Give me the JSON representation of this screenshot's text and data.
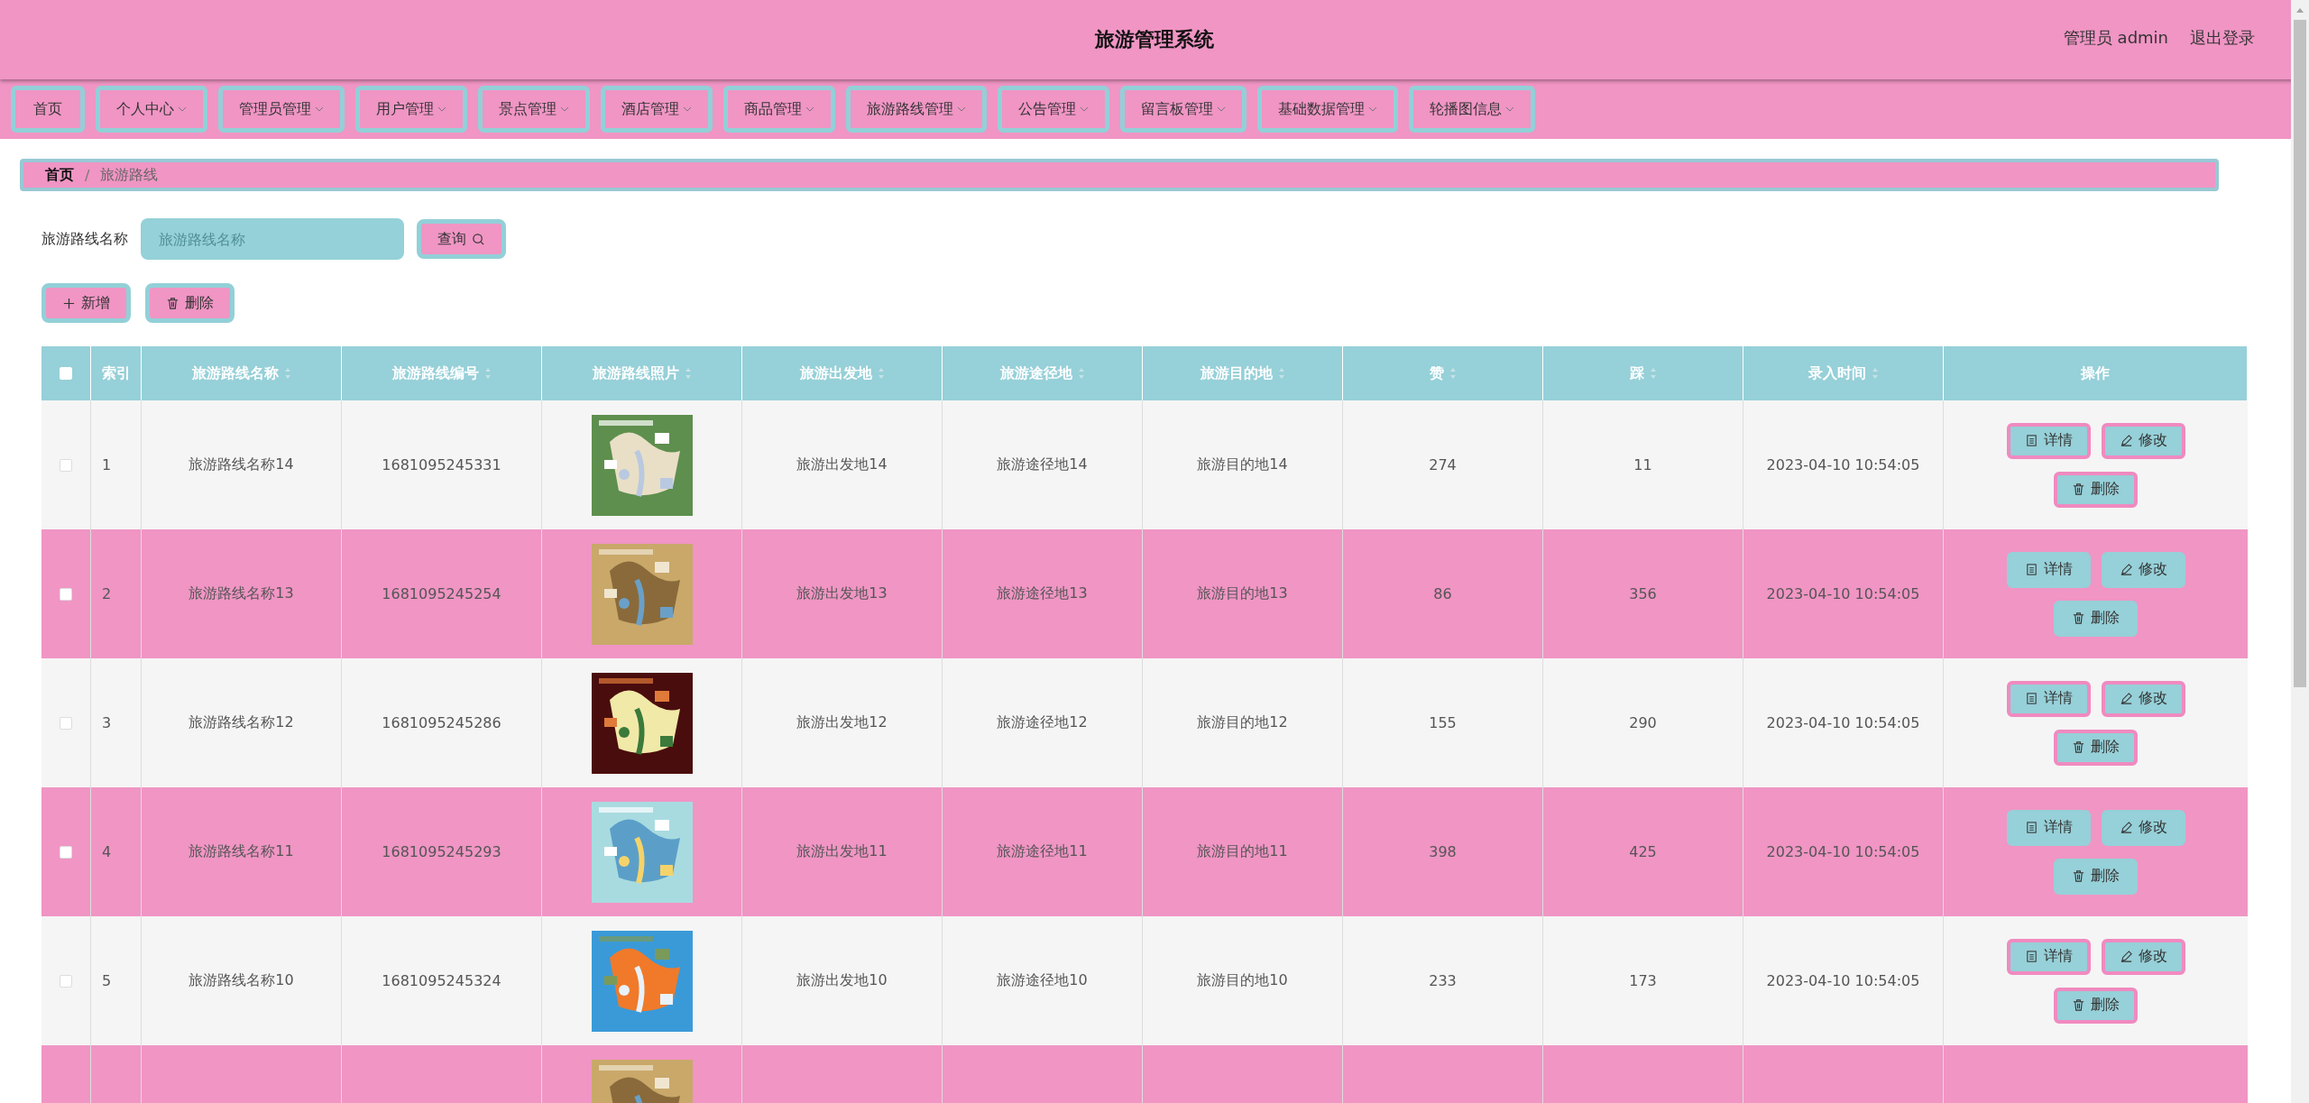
{
  "header": {
    "title": "旅游管理系统",
    "user": "管理员 admin",
    "logout": "退出登录"
  },
  "nav": [
    {
      "label": "首页",
      "dropdown": false
    },
    {
      "label": "个人中心",
      "dropdown": true
    },
    {
      "label": "管理员管理",
      "dropdown": true
    },
    {
      "label": "用户管理",
      "dropdown": true
    },
    {
      "label": "景点管理",
      "dropdown": true
    },
    {
      "label": "酒店管理",
      "dropdown": true
    },
    {
      "label": "商品管理",
      "dropdown": true
    },
    {
      "label": "旅游路线管理",
      "dropdown": true
    },
    {
      "label": "公告管理",
      "dropdown": true
    },
    {
      "label": "留言板管理",
      "dropdown": true
    },
    {
      "label": "基础数据管理",
      "dropdown": true
    },
    {
      "label": "轮播图信息",
      "dropdown": true
    }
  ],
  "breadcrumb": [
    "首页",
    "旅游路线"
  ],
  "breadcrumb_separator": "/",
  "search": {
    "label": "旅游路线名称",
    "placeholder": "旅游路线名称",
    "button": "查询"
  },
  "actions": [
    {
      "kind": "add",
      "label": "新增"
    },
    {
      "kind": "delete",
      "label": "删除"
    }
  ],
  "table": {
    "select_all": {
      "checked": false
    },
    "columns": [
      {
        "label": "索引",
        "sortable": false
      },
      {
        "label": "旅游路线名称",
        "sortable": true
      },
      {
        "label": "旅游路线编号",
        "sortable": true
      },
      {
        "label": "旅游路线照片",
        "sortable": true
      },
      {
        "label": "旅游出发地",
        "sortable": true
      },
      {
        "label": "旅游途径地",
        "sortable": true
      },
      {
        "label": "旅游目的地",
        "sortable": true
      },
      {
        "label": "赞",
        "sortable": true
      },
      {
        "label": "踩",
        "sortable": true
      },
      {
        "label": "录入时间",
        "sortable": true
      },
      {
        "label": "操作",
        "sortable": false
      }
    ],
    "rows": [
      {
        "kind": "full",
        "checked": false,
        "cells": [
          "1",
          "旅游路线名称14",
          "1681095245331",
          "旅游出发地14",
          "旅游途径地14",
          "旅游目的地14",
          "274",
          "11",
          "2023-04-10 10:54:05"
        ],
        "buttons": [
          "详情",
          "修改",
          "删除"
        ]
      },
      {
        "kind": "full",
        "checked": false,
        "cells": [
          "2",
          "旅游路线名称13",
          "1681095245254",
          "旅游出发地13",
          "旅游途径地13",
          "旅游目的地13",
          "86",
          "356",
          "2023-04-10 10:54:05"
        ],
        "buttons": [
          "详情",
          "修改",
          "删除"
        ]
      },
      {
        "kind": "full",
        "checked": false,
        "cells": [
          "3",
          "旅游路线名称12",
          "1681095245286",
          "旅游出发地12",
          "旅游途径地12",
          "旅游目的地12",
          "155",
          "290",
          "2023-04-10 10:54:05"
        ],
        "buttons": [
          "详情",
          "修改",
          "删除"
        ]
      },
      {
        "kind": "full",
        "checked": false,
        "cells": [
          "4",
          "旅游路线名称11",
          "1681095245293",
          "旅游出发地11",
          "旅游途径地11",
          "旅游目的地11",
          "398",
          "425",
          "2023-04-10 10:54:05"
        ],
        "buttons": [
          "详情",
          "修改",
          "删除"
        ]
      },
      {
        "kind": "full",
        "checked": false,
        "cells": [
          "5",
          "旅游路线名称10",
          "1681095245324",
          "旅游出发地10",
          "旅游途径地10",
          "旅游目的地10",
          "233",
          "173",
          "2023-04-10 10:54:05"
        ],
        "buttons": [
          "详情",
          "修改",
          "删除"
        ]
      },
      {
        "kind": "partial"
      }
    ]
  }
}
